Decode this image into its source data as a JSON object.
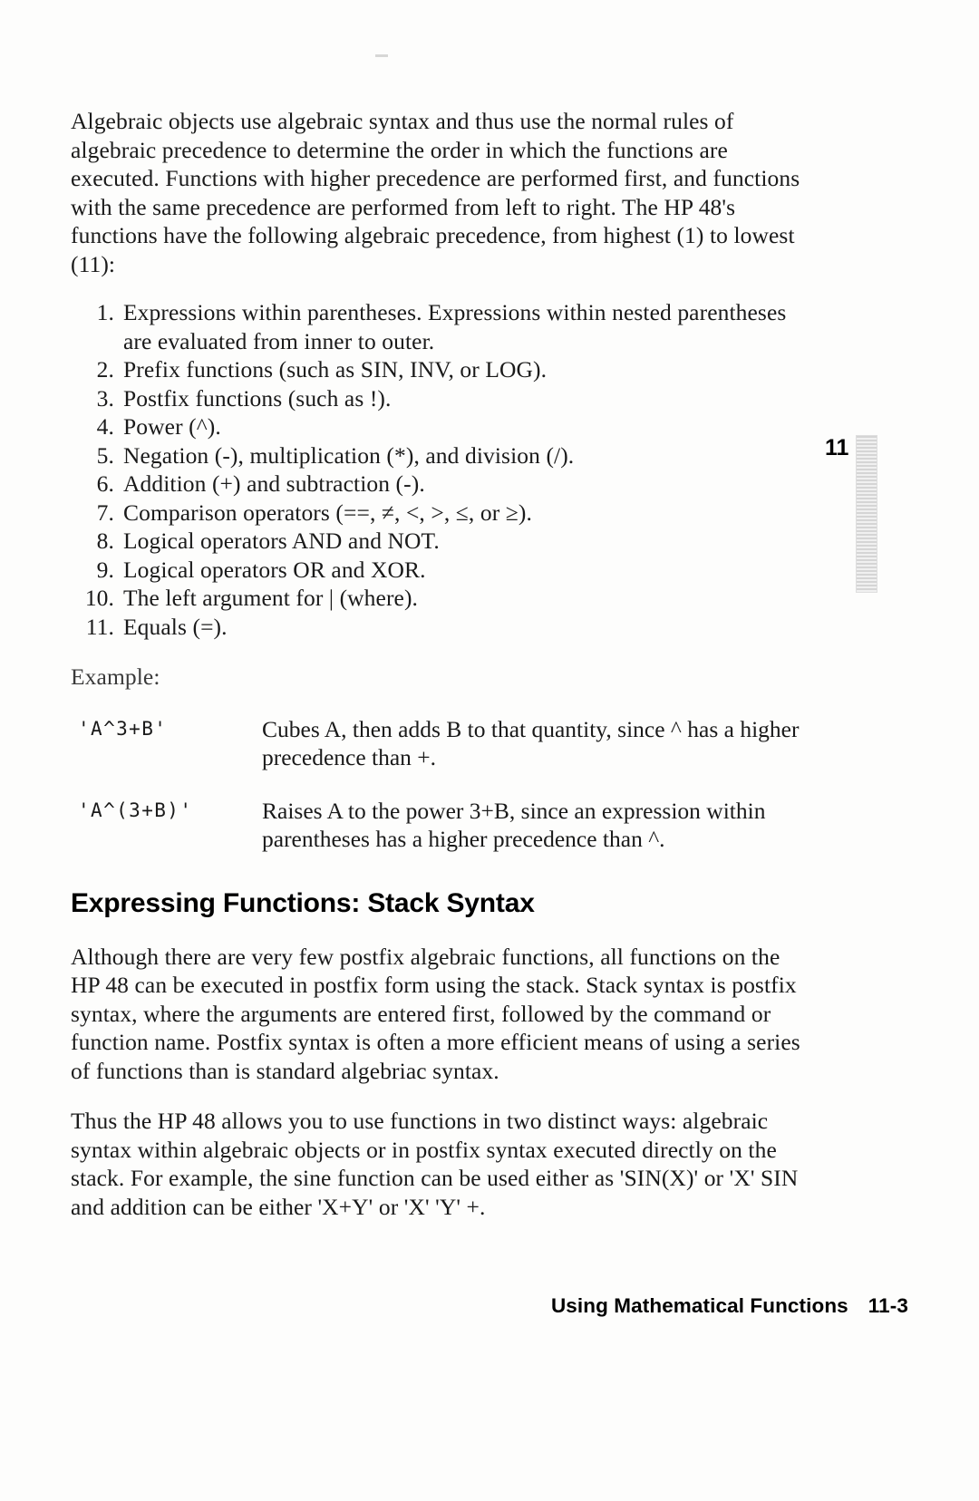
{
  "document": {
    "intro_paragraph": "Algebraic objects use algebraic syntax and thus use the normal rules of algebraic precedence to determine the order in which the functions are executed. Functions with higher precedence are performed first, and functions with the same precedence are performed from left to right. The HP 48's functions have the following algebraic precedence, from highest (1) to lowest (11):",
    "precedence_list": [
      {
        "number": "1.",
        "text": "Expressions within parentheses. Expressions within nested parentheses are evaluated from inner to outer."
      },
      {
        "number": "2.",
        "text": "Prefix functions (such as SIN, INV, or LOG)."
      },
      {
        "number": "3.",
        "text": "Postfix functions (such as !)."
      },
      {
        "number": "4.",
        "text": "Power (^)."
      },
      {
        "number": "5.",
        "text": "Negation (-), multiplication (*), and division (/)."
      },
      {
        "number": "6.",
        "text": "Addition (+) and subtraction (-)."
      },
      {
        "number": "7.",
        "text": "Comparison operators (==, ≠, <, >, ≤, or ≥)."
      },
      {
        "number": "8.",
        "text": "Logical operators AND and NOT."
      },
      {
        "number": "9.",
        "text": "Logical operators OR and XOR."
      },
      {
        "number": "10.",
        "text": "The left argument for | (where)."
      },
      {
        "number": "11.",
        "text": "Equals (=)."
      }
    ],
    "example_label": "Example:",
    "examples": [
      {
        "key": "'A^3+B'",
        "description": "Cubes A, then adds B to that quantity, since ^ has a higher precedence than +."
      },
      {
        "key": "'A^(3+B)'",
        "description": "Raises A to the power 3+B, since an expression within parentheses has a higher precedence than ^."
      }
    ],
    "section_heading": "Expressing Functions: Stack Syntax",
    "section_paragraph_1": "Although there are very few postfix algebraic functions, all functions on the HP 48 can be executed in postfix form using the stack. Stack syntax is postfix syntax, where the arguments are entered first, followed by the command or function name. Postfix syntax is often a more efficient means of using a series of functions than is standard algebriac syntax.",
    "section_paragraph_2": "Thus the HP 48 allows you to use functions in two distinct ways: algebraic syntax within algebraic objects or in postfix syntax executed directly on the stack. For example, the sine function can be used either as 'SIN(X)' or 'X' SIN and addition can be either 'X+Y' or 'X' 'Y' +."
  },
  "chapter_tab": {
    "number": "11"
  },
  "footer": {
    "title": "Using Mathematical Functions",
    "page_number": "11-3"
  }
}
